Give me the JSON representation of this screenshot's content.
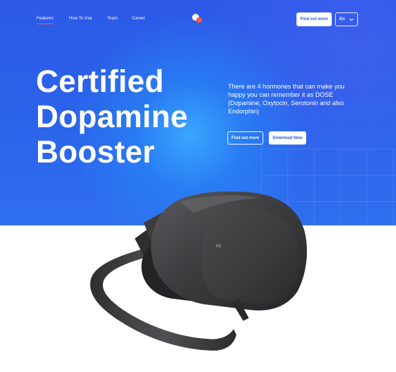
{
  "nav": {
    "links": [
      {
        "label": "Features",
        "active": true
      },
      {
        "label": "How To Use",
        "active": false
      },
      {
        "label": "Team",
        "active": false
      },
      {
        "label": "Career",
        "active": false
      }
    ],
    "cta_label": "Find out more",
    "language": "En"
  },
  "hero": {
    "headline": [
      "Certified",
      "Dopamine",
      "Booster"
    ],
    "description": "There are 4 hormones that can make you happy you can remember it as DOSE (Dopamine, Oxytocin, Serotonin and also Endorphin)",
    "primary_button": "Find out more",
    "secondary_button": "Download Now"
  },
  "product": {
    "brand_mark": "⋈"
  },
  "colors": {
    "hero_blue": "#2d59e8",
    "accent": "#ff5a3c",
    "headset_dark": "#3b3b3d"
  }
}
